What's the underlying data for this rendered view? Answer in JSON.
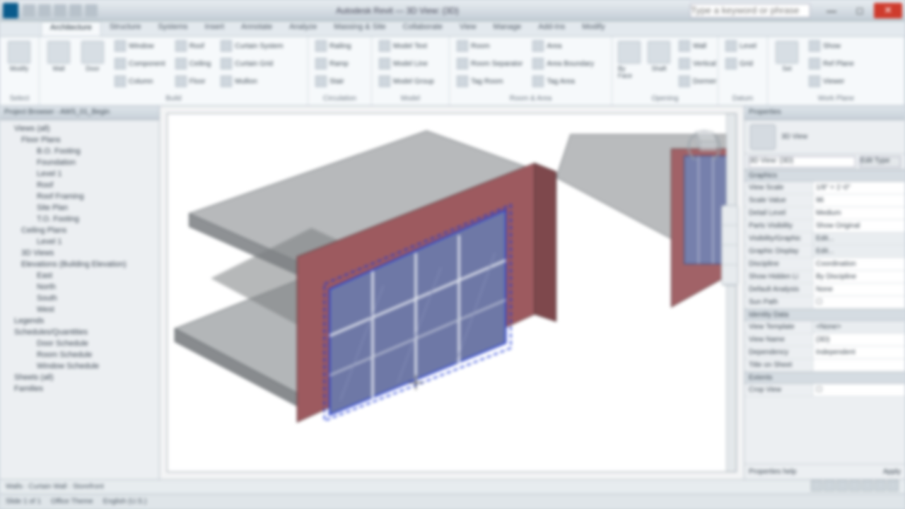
{
  "titlebar": {
    "title": "Autodesk Revit — 3D View: {3D}",
    "search_placeholder": "Type a keyword or phrase"
  },
  "ribbon_tabs": [
    "Architecture",
    "Structure",
    "Systems",
    "Insert",
    "Annotate",
    "Analyze",
    "Massing & Site",
    "Collaborate",
    "View",
    "Manage",
    "Add-Ins",
    "Modify"
  ],
  "ribbon": {
    "select": {
      "modify": "Modify"
    },
    "build": {
      "label": "Build",
      "big": [
        {
          "t": "Wall"
        },
        {
          "t": "Door"
        }
      ],
      "cols": [
        [
          "Window",
          "Component",
          "Column"
        ],
        [
          "Roof",
          "Ceiling",
          "Floor"
        ],
        [
          "Curtain System",
          "Curtain Grid",
          "Mullion"
        ]
      ]
    },
    "circulation": {
      "label": "Circulation",
      "items": [
        "Railing",
        "Ramp",
        "Stair"
      ]
    },
    "model": {
      "label": "Model",
      "items": [
        "Model Text",
        "Model Line",
        "Model Group"
      ]
    },
    "room_area": {
      "label": "Room & Area",
      "items": [
        "Room",
        "Room Separator",
        "Tag Room"
      ],
      "items2": [
        "Area",
        "Area Boundary",
        "Tag Area"
      ]
    },
    "opening": {
      "label": "Opening",
      "big": [
        {
          "t": "By Face"
        },
        {
          "t": "Shaft"
        }
      ],
      "items": [
        "Wall",
        "Vertical",
        "Dormer"
      ]
    },
    "datum": {
      "label": "Datum",
      "items": [
        "Level",
        "Grid"
      ]
    },
    "workplane": {
      "label": "Work Plane",
      "big": [
        {
          "t": "Set"
        }
      ],
      "items": [
        "Show",
        "Ref Plane",
        "Viewer"
      ]
    }
  },
  "browser": {
    "title": "Project Browser - AWS_01_Begin",
    "nodes": [
      {
        "lv": 0,
        "t": "Views (all)"
      },
      {
        "lv": 1,
        "t": "Floor Plans"
      },
      {
        "lv": 2,
        "t": "B.O. Footing"
      },
      {
        "lv": 2,
        "t": "Foundation"
      },
      {
        "lv": 2,
        "t": "Level 1"
      },
      {
        "lv": 2,
        "t": "Roof"
      },
      {
        "lv": 2,
        "t": "Roof Framing"
      },
      {
        "lv": 2,
        "t": "Site Plan"
      },
      {
        "lv": 2,
        "t": "T.O. Footing"
      },
      {
        "lv": 1,
        "t": "Ceiling Plans"
      },
      {
        "lv": 2,
        "t": "Level 1"
      },
      {
        "lv": 1,
        "t": "3D Views"
      },
      {
        "lv": 1,
        "t": "Elevations (Building Elevation)"
      },
      {
        "lv": 2,
        "t": "East"
      },
      {
        "lv": 2,
        "t": "North"
      },
      {
        "lv": 2,
        "t": "South"
      },
      {
        "lv": 2,
        "t": "West"
      },
      {
        "lv": 0,
        "t": "Legends"
      },
      {
        "lv": 0,
        "t": "Schedules/Quantities"
      },
      {
        "lv": 2,
        "t": "Door Schedule"
      },
      {
        "lv": 2,
        "t": "Room Schedule"
      },
      {
        "lv": 2,
        "t": "Window Schedule"
      },
      {
        "lv": 0,
        "t": "Sheets (all)"
      },
      {
        "lv": 0,
        "t": "Families"
      }
    ]
  },
  "props": {
    "title": "Properties",
    "type": "3D View",
    "selector": "3D View: {3D}",
    "edit_type": "Edit Type",
    "sections": [
      {
        "h": "Graphics",
        "rows": [
          {
            "k": "View Scale",
            "v": "1/8\" = 1'-0\""
          },
          {
            "k": "Scale Value",
            "v": "96"
          },
          {
            "k": "Detail Level",
            "v": "Medium"
          },
          {
            "k": "Parts Visibility",
            "v": "Show Original"
          },
          {
            "k": "Visibility/Graphic",
            "v": "Edit...",
            "btn": true
          },
          {
            "k": "Graphic Display",
            "v": "Edit...",
            "btn": true
          },
          {
            "k": "Discipline",
            "v": "Coordination"
          },
          {
            "k": "Show Hidden Li",
            "v": "By Discipline"
          },
          {
            "k": "Default Analysis",
            "v": "None"
          },
          {
            "k": "Sun Path",
            "v": "☐"
          }
        ]
      },
      {
        "h": "Identity Data",
        "rows": [
          {
            "k": "View Template",
            "v": "<None>",
            "btn": true
          },
          {
            "k": "View Name",
            "v": "{3D}"
          },
          {
            "k": "Dependency",
            "v": "Independent"
          },
          {
            "k": "Title on Sheet",
            "v": ""
          }
        ]
      },
      {
        "h": "Extents",
        "rows": [
          {
            "k": "Crop View",
            "v": "☐"
          }
        ]
      }
    ],
    "footer": {
      "l": "Properties help",
      "r": "Apply"
    }
  },
  "status": {
    "left": "Walls : Curtain Wall : Storefront"
  },
  "taskbar": {
    "a": "Slide 1 of 1",
    "b": "Office Theme",
    "c": "English (U.S.)"
  }
}
